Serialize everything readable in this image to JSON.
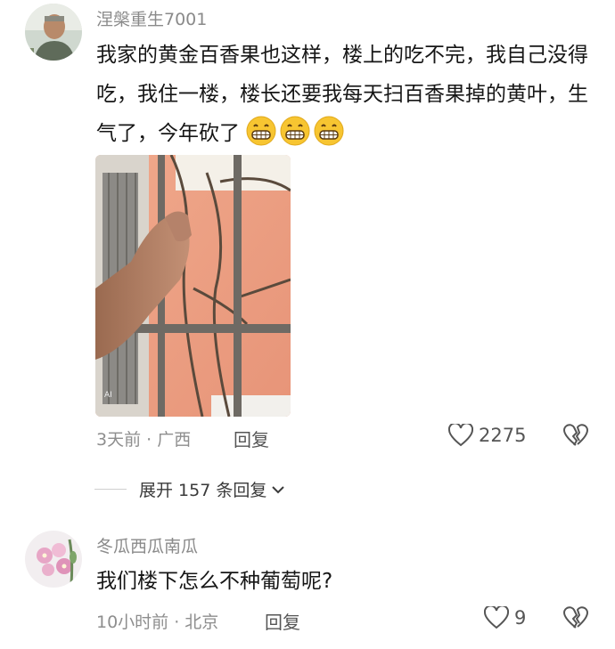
{
  "comments": [
    {
      "username": "涅槃重生7001",
      "text": "我家的黄金百香果也这样，楼上的吃不完，我自己没得吃，我住一楼，楼长还要我每天扫百香果掉的黄叶，生气了，今年砍了",
      "emojis": [
        "grin-emoji",
        "grin-emoji",
        "grin-emoji"
      ],
      "meta": "3天前 · 广西",
      "reply_label": "回复",
      "likes": "2275"
    },
    {
      "username": "冬瓜西瓜南瓜",
      "text": "我们楼下怎么不种葡萄呢?",
      "meta": "10小时前 · 北京",
      "reply_label": "回复",
      "likes": "9"
    }
  ],
  "expand_replies_label": "展开 157 条回复",
  "colors": {
    "meta_gray": "#8e8e8e",
    "text_dark": "#161616",
    "emoji_yellow": "#f7c531"
  }
}
